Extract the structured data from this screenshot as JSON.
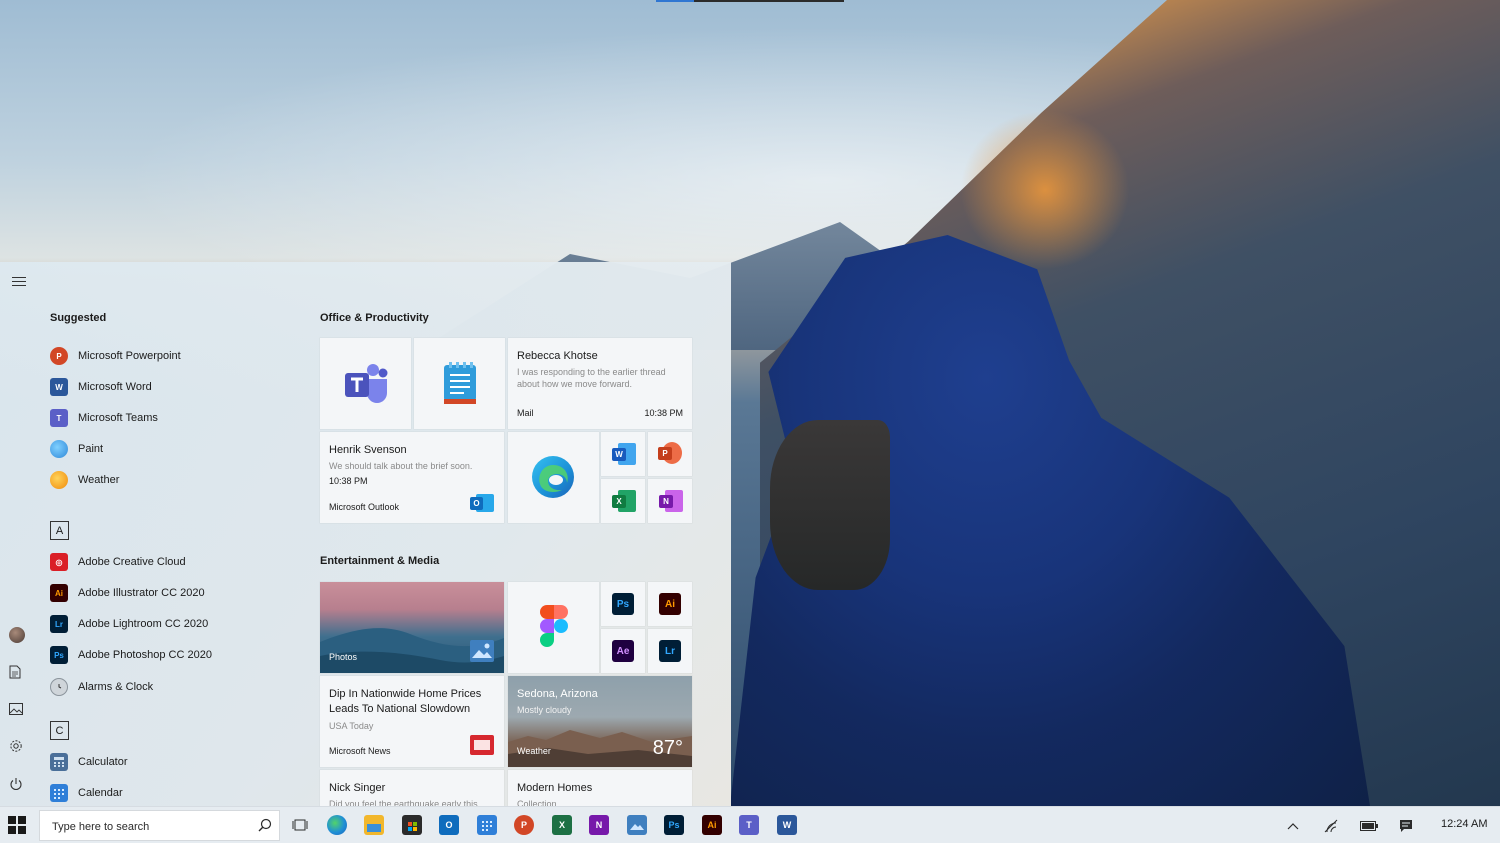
{
  "start_menu": {
    "suggested_header": "Suggested",
    "suggested": [
      {
        "label": "Microsoft Powerpoint",
        "icon": "powerpoint-icon",
        "color": "#d24726",
        "glyph": "P"
      },
      {
        "label": "Microsoft Word",
        "icon": "word-icon",
        "color": "#2b579a",
        "glyph": "W"
      },
      {
        "label": "Microsoft Teams",
        "icon": "teams-icon",
        "color": "#5b5fc7",
        "glyph": "T"
      },
      {
        "label": "Paint",
        "icon": "paint-icon",
        "color": "#3a96dd",
        "glyph": ""
      },
      {
        "label": "Weather",
        "icon": "weather-icon",
        "color": "#f0a30a",
        "glyph": ""
      }
    ],
    "letter_a": "A",
    "a_apps": [
      {
        "label": "Adobe Creative Cloud",
        "icon": "creative-cloud-icon",
        "color": "#da1f26",
        "glyph": "cc"
      },
      {
        "label": "Adobe Illustrator CC 2020",
        "icon": "illustrator-icon",
        "color": "#330000",
        "glyph": "Ai"
      },
      {
        "label": "Adobe Lightroom CC 2020",
        "icon": "lightroom-icon",
        "color": "#001e36",
        "glyph": "Lr"
      },
      {
        "label": "Adobe Photoshop CC 2020",
        "icon": "photoshop-icon",
        "color": "#001e36",
        "glyph": "Ps"
      },
      {
        "label": "Alarms & Clock",
        "icon": "alarm-clock-icon",
        "color": "#9aa3ab",
        "glyph": ""
      }
    ],
    "letter_c": "C",
    "c_apps": [
      {
        "label": "Calculator",
        "icon": "calculator-icon",
        "color": "#4a6f99",
        "glyph": ""
      },
      {
        "label": "Calendar",
        "icon": "calendar-icon",
        "color": "#2f7fd8",
        "glyph": ""
      }
    ],
    "office_header": "Office & Productivity",
    "entertainment_header": "Entertainment & Media",
    "mail_tile": {
      "sender": "Rebecca Khotse",
      "preview": "I was responding to the earlier thread about how we move forward.",
      "app": "Mail",
      "time": "10:38 PM"
    },
    "outlook_tile": {
      "sender": "Henrik Svenson",
      "preview": "We should talk about the brief soon.",
      "time": "10:38 PM",
      "app": "Microsoft Outlook"
    },
    "photos_tile": {
      "label": "Photos"
    },
    "news_tile": {
      "headline_1": "Dip In Nationwide Home Prices",
      "headline_2": "Leads To National Slowdown",
      "source": "USA Today",
      "app": "Microsoft News"
    },
    "weather_tile": {
      "location": "Sedona, Arizona",
      "condition": "Mostly cloudy",
      "app": "Weather",
      "temperature": "87°"
    },
    "nick_tile": {
      "sender": "Nick Singer",
      "preview": "Did you feel the earthquake early this"
    },
    "homes_tile": {
      "title": "Modern Homes",
      "sub": "Collection"
    },
    "small_tiles": {
      "word": "W",
      "powerpoint": "P",
      "excel": "X",
      "onenote": "N",
      "photoshop": "Ps",
      "illustrator": "Ai",
      "aftereffects": "Ae",
      "lightroom": "Lr"
    }
  },
  "taskbar": {
    "search_placeholder": "Type here to search",
    "clock": "12:24 AM",
    "apps": [
      {
        "name": "edge-icon",
        "color": "#1f8fd6",
        "glyph": ""
      },
      {
        "name": "file-explorer-icon",
        "color": "#f2b72c",
        "glyph": ""
      },
      {
        "name": "store-icon",
        "color": "#2b2b2b",
        "glyph": ""
      },
      {
        "name": "outlook-icon",
        "color": "#0f6cbd",
        "glyph": "O"
      },
      {
        "name": "calendar-icon",
        "color": "#2f7fd8",
        "glyph": ""
      },
      {
        "name": "powerpoint-icon",
        "color": "#d24726",
        "glyph": "P"
      },
      {
        "name": "excel-icon",
        "color": "#1d7044",
        "glyph": "X"
      },
      {
        "name": "onenote-icon",
        "color": "#7719aa",
        "glyph": "N"
      },
      {
        "name": "photos-icon",
        "color": "#3f7fbf",
        "glyph": ""
      },
      {
        "name": "photoshop-icon",
        "color": "#001e36",
        "glyph": "Ps"
      },
      {
        "name": "illustrator-icon",
        "color": "#330000",
        "glyph": "Ai"
      },
      {
        "name": "teams-icon",
        "color": "#5b5fc7",
        "glyph": "T"
      },
      {
        "name": "word-icon",
        "color": "#2b579a",
        "glyph": "W"
      }
    ]
  }
}
